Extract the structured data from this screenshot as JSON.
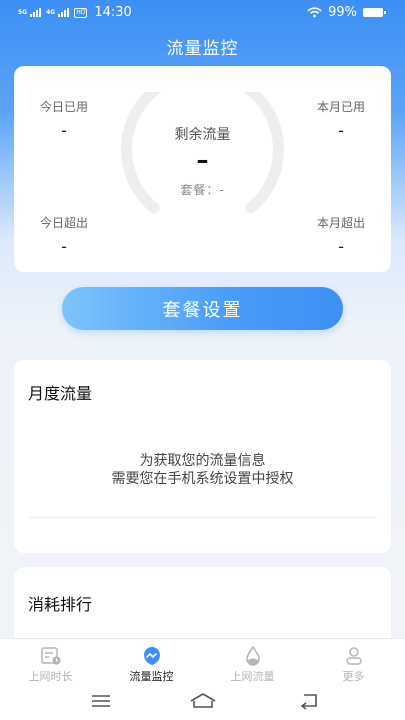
{
  "status_bar": {
    "network_1": "5G",
    "network_2": "4G",
    "hd": "HD",
    "time": "14:30",
    "battery": "99%"
  },
  "header": {
    "title": "流量监控"
  },
  "summary": {
    "today_used_label": "今日已用",
    "today_used_value": "-",
    "month_used_label": "本月已用",
    "month_used_value": "-",
    "today_over_label": "今日超出",
    "today_over_value": "-",
    "month_over_label": "本月超出",
    "month_over_value": "-",
    "remaining_label": "剩余流量",
    "remaining_value": "–",
    "plan_text": "套餐：-"
  },
  "plan_button": {
    "label": "套餐设置"
  },
  "monthly": {
    "title": "月度流量",
    "auth_line1": "为获取您的流量信息",
    "auth_line2": "需要您在手机系统设置中授权"
  },
  "ranking": {
    "title": "消耗排行"
  },
  "tabs": [
    {
      "label": "上网时长",
      "icon": "calendar-clock-icon",
      "active": false
    },
    {
      "label": "流量监控",
      "icon": "monitor-wave-icon",
      "active": true
    },
    {
      "label": "上网流量",
      "icon": "water-drop-icon",
      "active": false
    },
    {
      "label": "更多",
      "icon": "person-icon",
      "active": false
    }
  ],
  "colors": {
    "primary": "#3d8ff5",
    "gauge_track": "#eeeeee",
    "tab_inactive": "#b5b5b5"
  }
}
